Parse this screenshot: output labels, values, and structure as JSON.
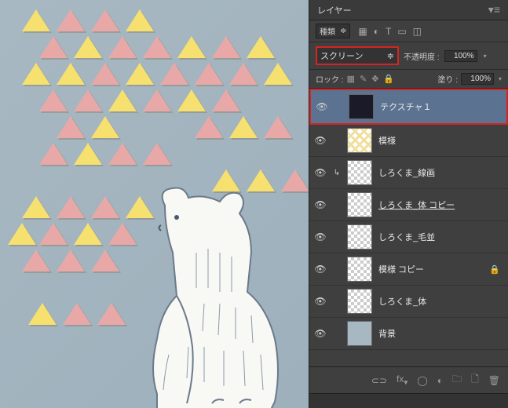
{
  "panel": {
    "title": "レイヤー"
  },
  "filter": {
    "label": "種類"
  },
  "blend": {
    "mode": "スクリーン",
    "opacityLabel": "不透明度 :",
    "opacityValue": "100%"
  },
  "lock": {
    "label": "ロック :",
    "fillLabel": "塗り :",
    "fillValue": "100%"
  },
  "layers": [
    {
      "name": "テクスチャ１",
      "thumb": "black",
      "selected": true
    },
    {
      "name": "模様",
      "thumb": "diamond"
    },
    {
      "name": "しろくま_線画",
      "thumb": "checker",
      "link": true
    },
    {
      "name": "しろくま_体 コピー",
      "thumb": "checker",
      "underline": true
    },
    {
      "name": "しろくま_毛並",
      "thumb": "checker"
    },
    {
      "name": "模様 コピー",
      "thumb": "checker",
      "locked": true
    },
    {
      "name": "しろくま_体",
      "thumb": "checker"
    },
    {
      "name": "背景",
      "thumb": "bluebg"
    }
  ]
}
